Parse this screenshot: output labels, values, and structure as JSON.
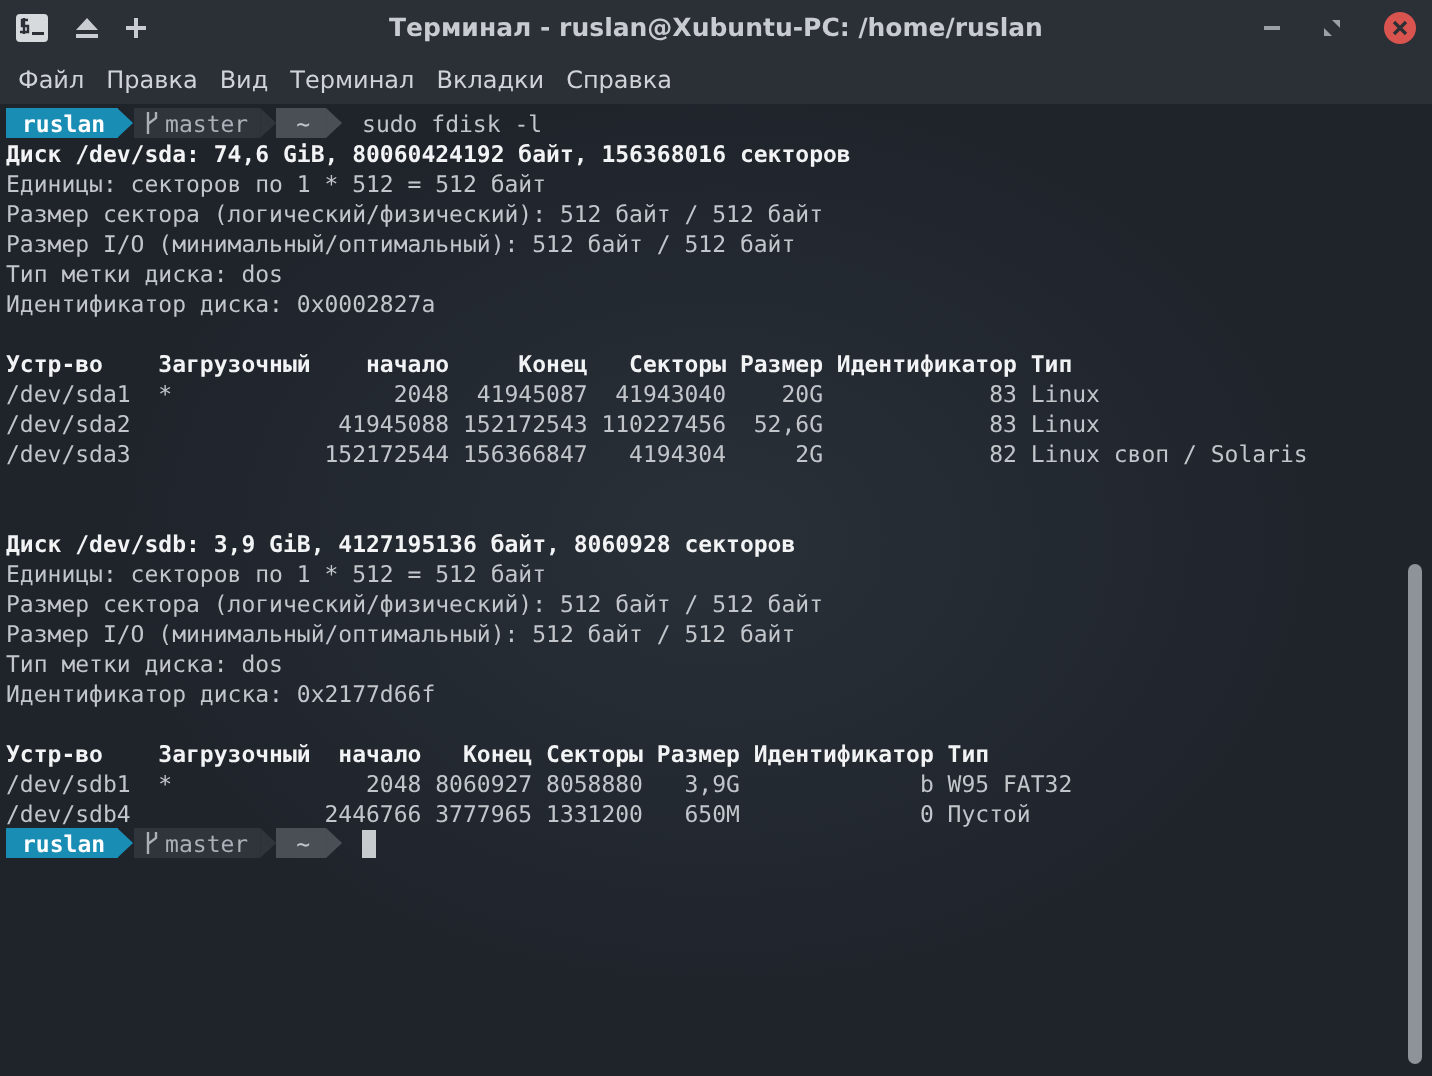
{
  "window": {
    "title": "Терминал - ruslan@Xubuntu-PC: /home/ruslan"
  },
  "menu": [
    {
      "label": "Файл"
    },
    {
      "label": "Правка"
    },
    {
      "label": "Вид"
    },
    {
      "label": "Терминал"
    },
    {
      "label": "Вкладки"
    },
    {
      "label": "Справка"
    }
  ],
  "lines": [
    {
      "kind": "prompt",
      "user": "ruslan",
      "branch": "master",
      "dir": "~",
      "command": "sudo fdisk -l",
      "cursor": false
    },
    {
      "kind": "bold",
      "text": "Диск /dev/sda: 74,6 GiB, 80060424192 байт, 156368016 секторов"
    },
    {
      "kind": "plain",
      "text": "Единицы: секторов по 1 * 512 = 512 байт"
    },
    {
      "kind": "plain",
      "text": "Размер сектора (логический/физический): 512 байт / 512 байт"
    },
    {
      "kind": "plain",
      "text": "Размер I/O (минимальный/оптимальный): 512 байт / 512 байт"
    },
    {
      "kind": "plain",
      "text": "Тип метки диска: dos"
    },
    {
      "kind": "plain",
      "text": "Идентификатор диска: 0x0002827a"
    },
    {
      "kind": "blank"
    },
    {
      "kind": "bold",
      "text": "Устр-во    Загрузочный    начало     Конец   Секторы Размер Идентификатор Тип"
    },
    {
      "kind": "plain",
      "text": "/dev/sda1  *                2048  41945087  41943040    20G            83 Linux"
    },
    {
      "kind": "plain",
      "text": "/dev/sda2               41945088 152172543 110227456  52,6G            83 Linux"
    },
    {
      "kind": "plain",
      "text": "/dev/sda3              152172544 156366847   4194304     2G            82 Linux своп / Solaris"
    },
    {
      "kind": "blank"
    },
    {
      "kind": "blank"
    },
    {
      "kind": "bold",
      "text": "Диск /dev/sdb: 3,9 GiB, 4127195136 байт, 8060928 секторов"
    },
    {
      "kind": "plain",
      "text": "Единицы: секторов по 1 * 512 = 512 байт"
    },
    {
      "kind": "plain",
      "text": "Размер сектора (логический/физический): 512 байт / 512 байт"
    },
    {
      "kind": "plain",
      "text": "Размер I/O (минимальный/оптимальный): 512 байт / 512 байт"
    },
    {
      "kind": "plain",
      "text": "Тип метки диска: dos"
    },
    {
      "kind": "plain",
      "text": "Идентификатор диска: 0x2177d66f"
    },
    {
      "kind": "blank"
    },
    {
      "kind": "bold",
      "text": "Устр-во    Загрузочный  начало   Конец Секторы Размер Идентификатор Тип"
    },
    {
      "kind": "plain",
      "text": "/dev/sdb1  *              2048 8060927 8058880   3,9G             b W95 FAT32"
    },
    {
      "kind": "plain",
      "text": "/dev/sdb4              2446766 3777965 1331200   650M             0 Пустой"
    },
    {
      "kind": "prompt",
      "user": "ruslan",
      "branch": "master",
      "dir": "~",
      "cursor": true
    }
  ]
}
